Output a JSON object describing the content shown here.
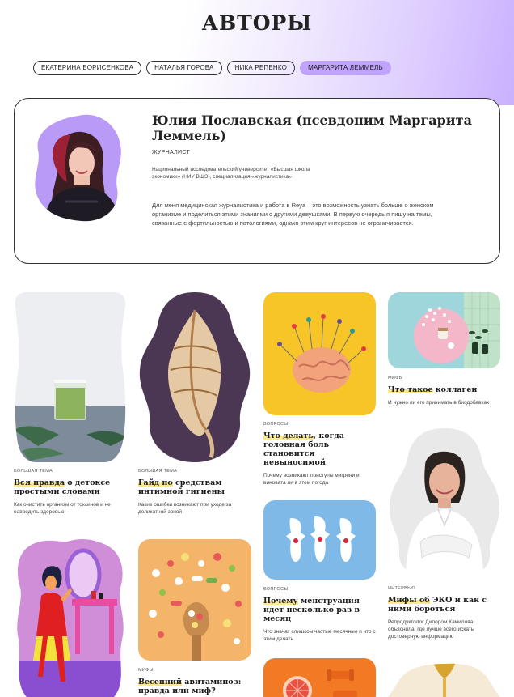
{
  "page": {
    "title": "АВТОРЫ"
  },
  "tabs": [
    {
      "label": "ЕКАТЕРИНА БОРИСЕНКОВА",
      "active": false
    },
    {
      "label": "НАТАЛЬЯ ГОРОВА",
      "active": false
    },
    {
      "label": "НИКА РЕПЕНКО",
      "active": false
    },
    {
      "label": "МАРГАРИТА ЛЕММЕЛЬ",
      "active": true
    }
  ],
  "author": {
    "name": "Юлия Пославская (псевдоним Маргарита Леммель)",
    "role": "ЖУРНАЛИСТ",
    "education": "Национальный исследовательский университет «Высшая школа экономики» (НИУ ВШЭ), специализация «журналистика»",
    "bio": "Для меня медицинская журналистика и работа в Reya – это возможность узнать больше о женском организме и поделиться этими знаниями с другими девушками. В первую очередь я пишу на темы, связанные с фертильностью и патологиями, однако этим круг интересов не ограничивается."
  },
  "articles": [
    {
      "kicker": "БОЛЬШАЯ ТЕМА",
      "title_hl": "Вся правда",
      "title_rest": " о детоксе простыми словами",
      "desc": "Как очистить организм от токсинов и не навредить здоровью",
      "image": "green-smoothie-glass"
    },
    {
      "kicker": "БОЛЬШАЯ ТЕМА",
      "title_hl": "Гайд по",
      "title_rest": " средствам интимной гигиены",
      "desc": "Какие ошибки возникают при уходе за деликатной зоной",
      "image": "seashell"
    },
    {
      "kicker": "ВОПРОСЫ",
      "title_hl": "Что делать",
      "title_rest": ", когда головная боль становится невыносимой",
      "desc": "Почему возникают приступы мигрени и виновата ли в этом погода",
      "image": "brain-with-pins"
    },
    {
      "kicker": "МИФЫ",
      "title_hl": "Что такое",
      "title_rest": " коллаген",
      "desc": "И нужно ли его принимать в биодобавках",
      "image": "pills-and-jars"
    },
    {
      "kicker": "ВОПРОСЫ",
      "title_hl": "Почему",
      "title_rest": " менструация идет несколько раз в месяц",
      "desc": "Что значат слишком частые месячные и что с этим делать",
      "image": "pads"
    },
    {
      "kicker": "ИНТЕРВЬЮ",
      "title_hl": "Мифы об",
      "title_rest": " ЭКО и как с ними бороться",
      "desc": "Репродуктолог Дилором Камилова объяснила, где лучше всего искать достоверную информацию",
      "image": "doctor-portrait"
    },
    {
      "kicker": "МИФЫ",
      "title_hl": "Весенний",
      "title_rest": " авитаминоз: правда или миф?",
      "desc": "",
      "image": "vitamins-spoon"
    },
    {
      "kicker": "",
      "title_hl": "",
      "title_rest": "",
      "desc": "",
      "image": "woman-mirror-illustration"
    },
    {
      "kicker": "",
      "title_hl": "",
      "title_rest": "",
      "desc": "",
      "image": "grapefruit-dumbbells"
    },
    {
      "kicker": "",
      "title_hl": "",
      "title_rest": "",
      "desc": "",
      "image": "honey-oil"
    }
  ]
}
